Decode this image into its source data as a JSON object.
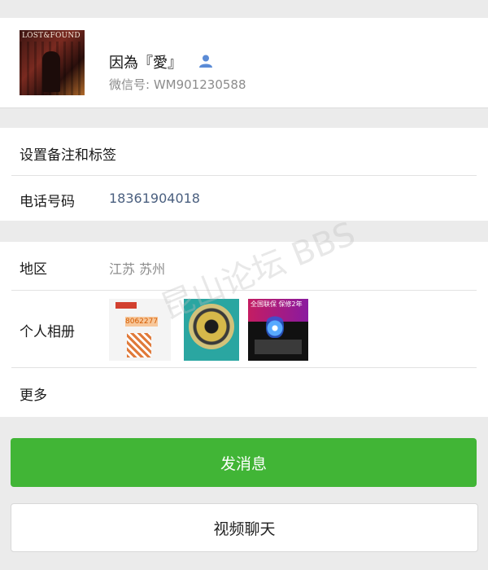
{
  "profile": {
    "avatar_logo": "LOST&FOUND",
    "nickname": "因為『愛』",
    "wechat_id": "微信号: WM901230588"
  },
  "rows": {
    "remark_label": "设置备注和标签",
    "phone_label": "电话号码",
    "phone_value": "18361904018",
    "region_label": "地区",
    "region_value": "江苏  苏州",
    "album_label": "个人相册",
    "more_label": "更多"
  },
  "album": {
    "thumb1_number": "8062277",
    "thumb3_text": "全国联保 保修2年"
  },
  "buttons": {
    "send_message": "发消息",
    "video_chat": "视频聊天"
  },
  "watermark": "昆山论坛 BBS",
  "colors": {
    "primary_green": "#41b536",
    "phone_blue": "#4a5f7f",
    "muted_gray": "#8c8c8c",
    "person_icon_blue": "#5b8bd6"
  },
  "icons": [
    "person-icon"
  ]
}
